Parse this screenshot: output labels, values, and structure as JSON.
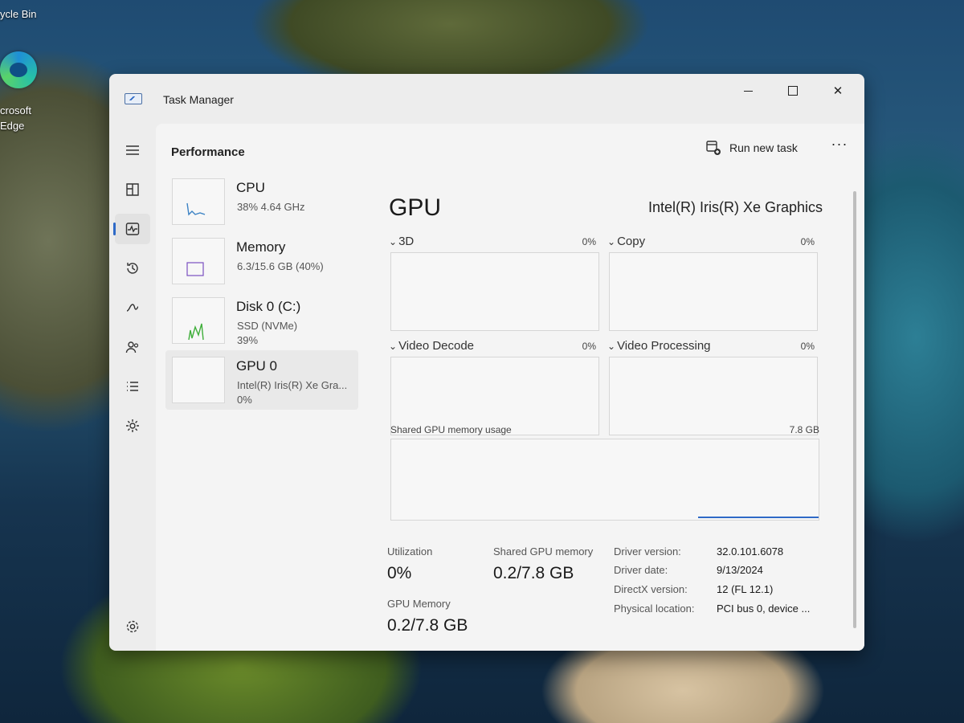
{
  "desktop": {
    "recycle_bin": "ycle Bin",
    "edge_line1": "crosoft",
    "edge_line2": "Edge"
  },
  "window": {
    "title": "Task Manager",
    "buttons": {
      "minimize": "—",
      "maximize": "□",
      "close": "✕"
    }
  },
  "nav": {
    "items": [
      {
        "icon": "hamburger-icon"
      },
      {
        "icon": "processes-icon"
      },
      {
        "icon": "performance-icon",
        "active": true
      },
      {
        "icon": "app-history-icon"
      },
      {
        "icon": "startup-apps-icon"
      },
      {
        "icon": "users-icon"
      },
      {
        "icon": "details-icon"
      },
      {
        "icon": "services-icon"
      },
      {
        "icon": "settings-icon"
      }
    ]
  },
  "header": {
    "page_title": "Performance",
    "run_new_task": "Run new task",
    "more": "···"
  },
  "list": [
    {
      "title": "CPU",
      "line1": "38%  4.64 GHz",
      "line2": ""
    },
    {
      "title": "Memory",
      "line1": "6.3/15.6 GB (40%)",
      "line2": ""
    },
    {
      "title": "Disk 0 (C:)",
      "line1": "SSD (NVMe)",
      "line2": "39%"
    },
    {
      "title": "GPU 0",
      "line1": "Intel(R) Iris(R) Xe Gra...",
      "line2": "0%",
      "selected": true
    }
  ],
  "gpu": {
    "heading": "GPU",
    "adapter": "Intel(R) Iris(R) Xe Graphics",
    "engines": [
      {
        "label": "3D",
        "percent": "0%"
      },
      {
        "label": "Copy",
        "percent": "0%"
      },
      {
        "label": "Video Decode",
        "percent": "0%"
      },
      {
        "label": "Video Processing",
        "percent": "0%"
      }
    ],
    "shared_usage_label": "Shared GPU memory usage",
    "shared_usage_max": "7.8 GB"
  },
  "stats": {
    "utilization": {
      "label": "Utilization",
      "value": "0%"
    },
    "shared_gpu_memory": {
      "label": "Shared GPU memory",
      "value": "0.2/7.8 GB"
    },
    "gpu_memory": {
      "label": "GPU Memory",
      "value": "0.2/7.8 GB"
    }
  },
  "details": [
    {
      "key": "Driver version:",
      "value": "32.0.101.6078"
    },
    {
      "key": "Driver date:",
      "value": "9/13/2024"
    },
    {
      "key": "DirectX version:",
      "value": "12 (FL 12.1)"
    },
    {
      "key": "Physical location:",
      "value": "PCI bus 0, device ..."
    }
  ],
  "colors": {
    "accent": "#2f6ac7",
    "cpu_graph": "#3b82c4",
    "memory_graph": "#7a4fc0",
    "disk_graph": "#3fae3a",
    "gpu_graph": "#2f6ac7"
  }
}
